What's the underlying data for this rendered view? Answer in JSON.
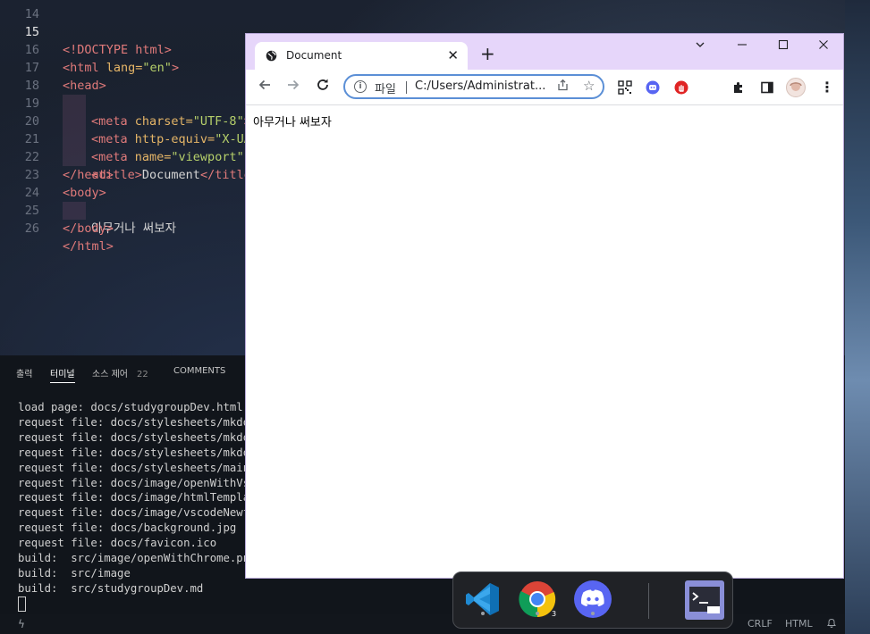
{
  "editor": {
    "lines": [
      {
        "n": "14"
      },
      {
        "n": "15",
        "current": true
      },
      {
        "n": "16"
      },
      {
        "n": "17"
      },
      {
        "n": "18"
      },
      {
        "n": "19"
      },
      {
        "n": "20"
      },
      {
        "n": "21"
      },
      {
        "n": "22"
      },
      {
        "n": "23"
      },
      {
        "n": "24"
      },
      {
        "n": "25"
      },
      {
        "n": "26"
      }
    ],
    "code": {
      "doctype": "<!DOCTYPE html>",
      "html_open_tag": "<html",
      "lang_attr": " lang=",
      "lang_val": "\"en\"",
      "html_open_close": ">",
      "head_open": "<head>",
      "meta1_tag": "<meta",
      "meta1_attr": " charset=",
      "meta1_val": "\"UTF-8\"",
      "meta1_end": ">",
      "meta2_tag": "<meta",
      "meta2_attr": " http-equiv=",
      "meta2_val": "\"X-UA",
      "meta3_tag": "<meta",
      "meta3_attr": " name=",
      "meta3_val": "\"viewport\"",
      "title_open": "<title>",
      "title_text": "Document",
      "title_close": "</title",
      "head_close": "</head>",
      "body_open": "<body>",
      "body_text": "아무거나 써보자",
      "body_close": "</body>",
      "html_close": "</html>"
    }
  },
  "panel": {
    "tabs": [
      {
        "label": "출력"
      },
      {
        "label": "터미널",
        "active": true
      },
      {
        "label": "소스 제어",
        "count": "22"
      },
      {
        "label": "COMMENTS"
      }
    ],
    "terminal_lines": [
      "load page: docs/studygroupDev.html",
      "request file: docs/stylesheets/mkdocs",
      "request file: docs/stylesheets/mkdocs",
      "request file: docs/stylesheets/mkdocs",
      "request file: docs/stylesheets/main.c",
      "request file: docs/image/openWithVsco",
      "request file: docs/image/htmlTemplate",
      "request file: docs/image/vscodeNewfil",
      "request file: docs/background.jpg",
      "request file: docs/favicon.ico",
      "build:  src/image/openWithChrome.png",
      "build:  src/image",
      "build:  src/studygroupDev.md"
    ]
  },
  "statusbar": {
    "eol": "CRLF",
    "language": "HTML"
  },
  "browser": {
    "tab_title": "Document",
    "address_scheme": "파일",
    "address_url": "C:/Users/Administrat...",
    "page_text": "아무거나 써보자"
  },
  "taskbar": {
    "chrome_badge": "3",
    "apps": [
      "vscode",
      "chrome",
      "discord",
      "terminal"
    ]
  },
  "colors": {
    "accent": "#5b8fd6",
    "tabstrip": "#e6d6fa",
    "editor_bg": "#1a1f28"
  }
}
